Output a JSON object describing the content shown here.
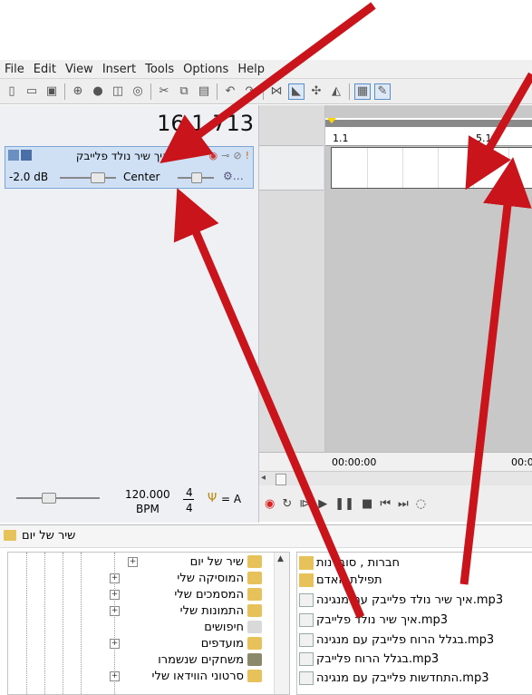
{
  "menubar": {
    "items": [
      "File",
      "Edit",
      "View",
      "Insert",
      "Tools",
      "Options",
      "Help"
    ]
  },
  "toolbar": {
    "icons": [
      "new-icon",
      "open-icon",
      "save-icon",
      "sep",
      "link-icon",
      "user-icon",
      "export-icon",
      "zoom-icon",
      "sep",
      "cut-icon",
      "copy-icon",
      "paste-icon",
      "sep",
      "undo-icon",
      "redo-icon",
      "sep",
      "snap-icon",
      "grid-icon",
      "split-icon",
      "mute-icon",
      "sep",
      "select-tool-icon",
      "pencil-tool-icon"
    ]
  },
  "transport_time": "16.1.713",
  "track": {
    "name": "איך שיר נולד פלייבק",
    "volume": "-2.0 dB",
    "pan": "Center"
  },
  "ruler": {
    "marks": [
      "1.1",
      "5.1"
    ]
  },
  "timebar": {
    "start": "00:00:00",
    "next": "00:0"
  },
  "tempo": {
    "bpm_value": "120.000",
    "bpm_label": "BPM",
    "ts_top": "4",
    "ts_bottom": "4",
    "tuning": "= A"
  },
  "browser": {
    "path": "שיר של יום",
    "tree": [
      "שיר של יום",
      "המוסיקה שלי",
      "המסמכים שלי",
      "התמונות שלי",
      "חיפושים",
      "מועדפים",
      "משחקים שנשמרו",
      "סרטוני הווידאו שלי"
    ],
    "files": [
      {
        "name": "חברות , סובלנות",
        "type": "folder"
      },
      {
        "name": "תפילת האדם",
        "type": "folder"
      },
      {
        "name": "איך שיר נולד פלייבק עם מנגינה.mp3",
        "type": "mp3"
      },
      {
        "name": "איך שיר נולד פלייבק.mp3",
        "type": "mp3"
      },
      {
        "name": "בגלל הרוח פלייבק עם מנגינה.mp3",
        "type": "mp3"
      },
      {
        "name": "בגלל הרוח פלייבק.mp3",
        "type": "mp3"
      },
      {
        "name": "התחדשות פלייבק עם מנגינה.mp3",
        "type": "mp3"
      }
    ]
  },
  "colors": {
    "annotation_arrow": "#c8141a",
    "track_header": "#cfe0f5",
    "folder": "#e7c15a"
  }
}
